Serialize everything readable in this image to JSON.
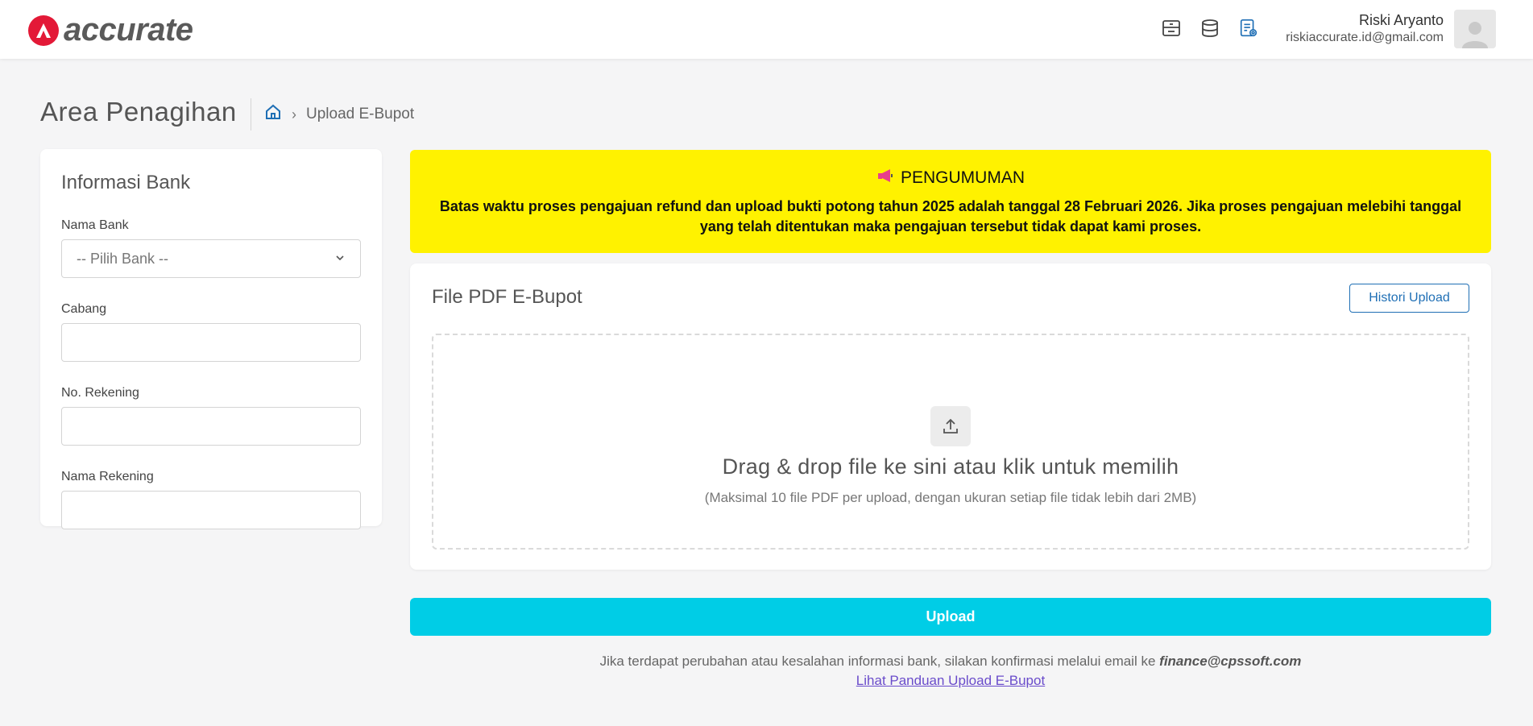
{
  "brand": {
    "name": "accurate",
    "color": "#e31937"
  },
  "header": {
    "icons": [
      "archive-icon",
      "database-icon",
      "document-settings-icon"
    ],
    "user": {
      "name": "Riski Aryanto",
      "email": "riskiaccurate.id@gmail.com"
    }
  },
  "page": {
    "title": "Area Penagihan",
    "breadcrumb": {
      "home_icon": "home-icon",
      "current": "Upload E-Bupot"
    }
  },
  "bank_form": {
    "title": "Informasi Bank",
    "fields": [
      {
        "label": "Nama Bank",
        "type": "select",
        "placeholder": "-- Pilih Bank --",
        "value": ""
      },
      {
        "label": "Cabang",
        "type": "text",
        "value": ""
      },
      {
        "label": "No. Rekening",
        "type": "text",
        "value": ""
      },
      {
        "label": "Nama Rekening",
        "type": "text",
        "value": ""
      }
    ]
  },
  "announcement": {
    "icon": "megaphone-icon",
    "title": "PENGUMUMAN",
    "text": "Batas waktu proses pengajuan refund dan upload bukti potong tahun 2025 adalah tanggal 28 Februari 2026. Jika proses pengajuan melebihi tanggal yang telah ditentukan maka pengajuan tersebut tidak dapat kami proses.",
    "background": "#fff200"
  },
  "upload": {
    "title": "File PDF E-Bupot",
    "history_button": "Histori Upload",
    "dropzone_main": "Drag & drop file ke sini atau klik untuk memilih",
    "dropzone_sub": "(Maksimal 10 file PDF per upload, dengan ukuran setiap file tidak lebih dari 2MB)",
    "submit_label": "Upload",
    "submit_color": "#00cde6"
  },
  "footer": {
    "note": "Jika terdapat perubahan atau kesalahan informasi bank, silakan konfirmasi melalui email ke",
    "email": "finance@cpssoft.com",
    "guide_link": "Lihat Panduan Upload E-Bupot"
  }
}
